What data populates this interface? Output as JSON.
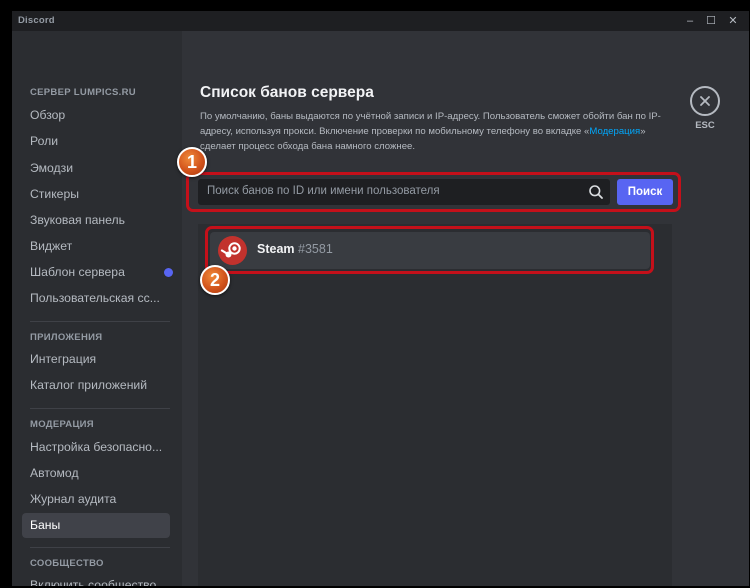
{
  "app": {
    "title": "Discord",
    "window_controls": {
      "minimize": "–",
      "maximize": "☐",
      "close": "✕"
    }
  },
  "sidebar": {
    "server_header": "СЕРВЕР LUMPICS.RU",
    "server_items": [
      {
        "label": "Обзор"
      },
      {
        "label": "Роли"
      },
      {
        "label": "Эмодзи"
      },
      {
        "label": "Стикеры"
      },
      {
        "label": "Звуковая панель"
      },
      {
        "label": "Виджет"
      },
      {
        "label": "Шаблон сервера"
      },
      {
        "label": "Пользовательская сс..."
      }
    ],
    "apps_header": "ПРИЛОЖЕНИЯ",
    "apps_items": [
      {
        "label": "Интеграция"
      },
      {
        "label": "Каталог приложений"
      }
    ],
    "moderation_header": "МОДЕРАЦИЯ",
    "moderation_items": [
      {
        "label": "Настройка безопасно..."
      },
      {
        "label": "Автомод"
      },
      {
        "label": "Журнал аудита"
      },
      {
        "label": "Баны",
        "active": true
      }
    ],
    "community_header": "СООБЩЕСТВО",
    "community_items": [
      {
        "label": "Включить сообщество"
      }
    ]
  },
  "main": {
    "title": "Список банов сервера",
    "description_before": "По умолчанию, баны выдаются по учётной записи и IP-адресу. Пользователь сможет обойти бан по IP-адресу, используя прокси. Включение проверки по мобильному телефону во вкладке «",
    "description_link": "Модерация",
    "description_after": "» сделает процесс обхода бана намного сложнее.",
    "search": {
      "placeholder": "Поиск банов по ID или имени пользователя",
      "button_label": "Поиск"
    },
    "bans": [
      {
        "name": "Steam",
        "tag": "#3581"
      }
    ],
    "close": {
      "label": "ESC"
    }
  },
  "annotations": [
    "1",
    "2"
  ],
  "colors": {
    "accent": "#5865f2",
    "highlight": "#c4101a",
    "link": "#00a8fc",
    "badge": "#d2541c"
  }
}
